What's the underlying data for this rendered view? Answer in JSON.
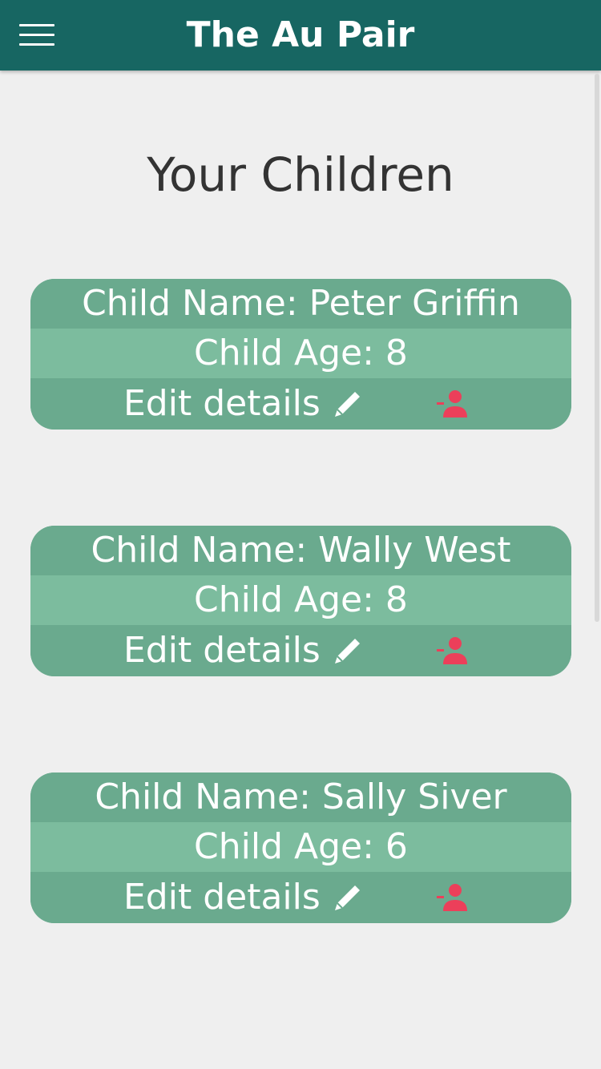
{
  "header": {
    "app_title": "The Au Pair",
    "menu_icon": "hamburger-menu-icon"
  },
  "page": {
    "heading": "Your Children"
  },
  "children": [
    {
      "name_line": "Child Name: Peter Griffin",
      "age_line": "Child Age: 8",
      "edit_label": "Edit details"
    },
    {
      "name_line": "Child Name: Wally West",
      "age_line": "Child Age: 8",
      "edit_label": "Edit details"
    },
    {
      "name_line": "Child Name: Sally Siver",
      "age_line": "Child Age: 6",
      "edit_label": "Edit details"
    }
  ],
  "icons": {
    "edit": "pencil-icon",
    "remove": "remove-person-icon"
  },
  "colors": {
    "header_bg": "#176662",
    "card_bg": "#6aaa8e",
    "card_age_bg": "#7cbc9e",
    "remove_icon": "#ec3f5a",
    "page_bg": "#efefef"
  }
}
